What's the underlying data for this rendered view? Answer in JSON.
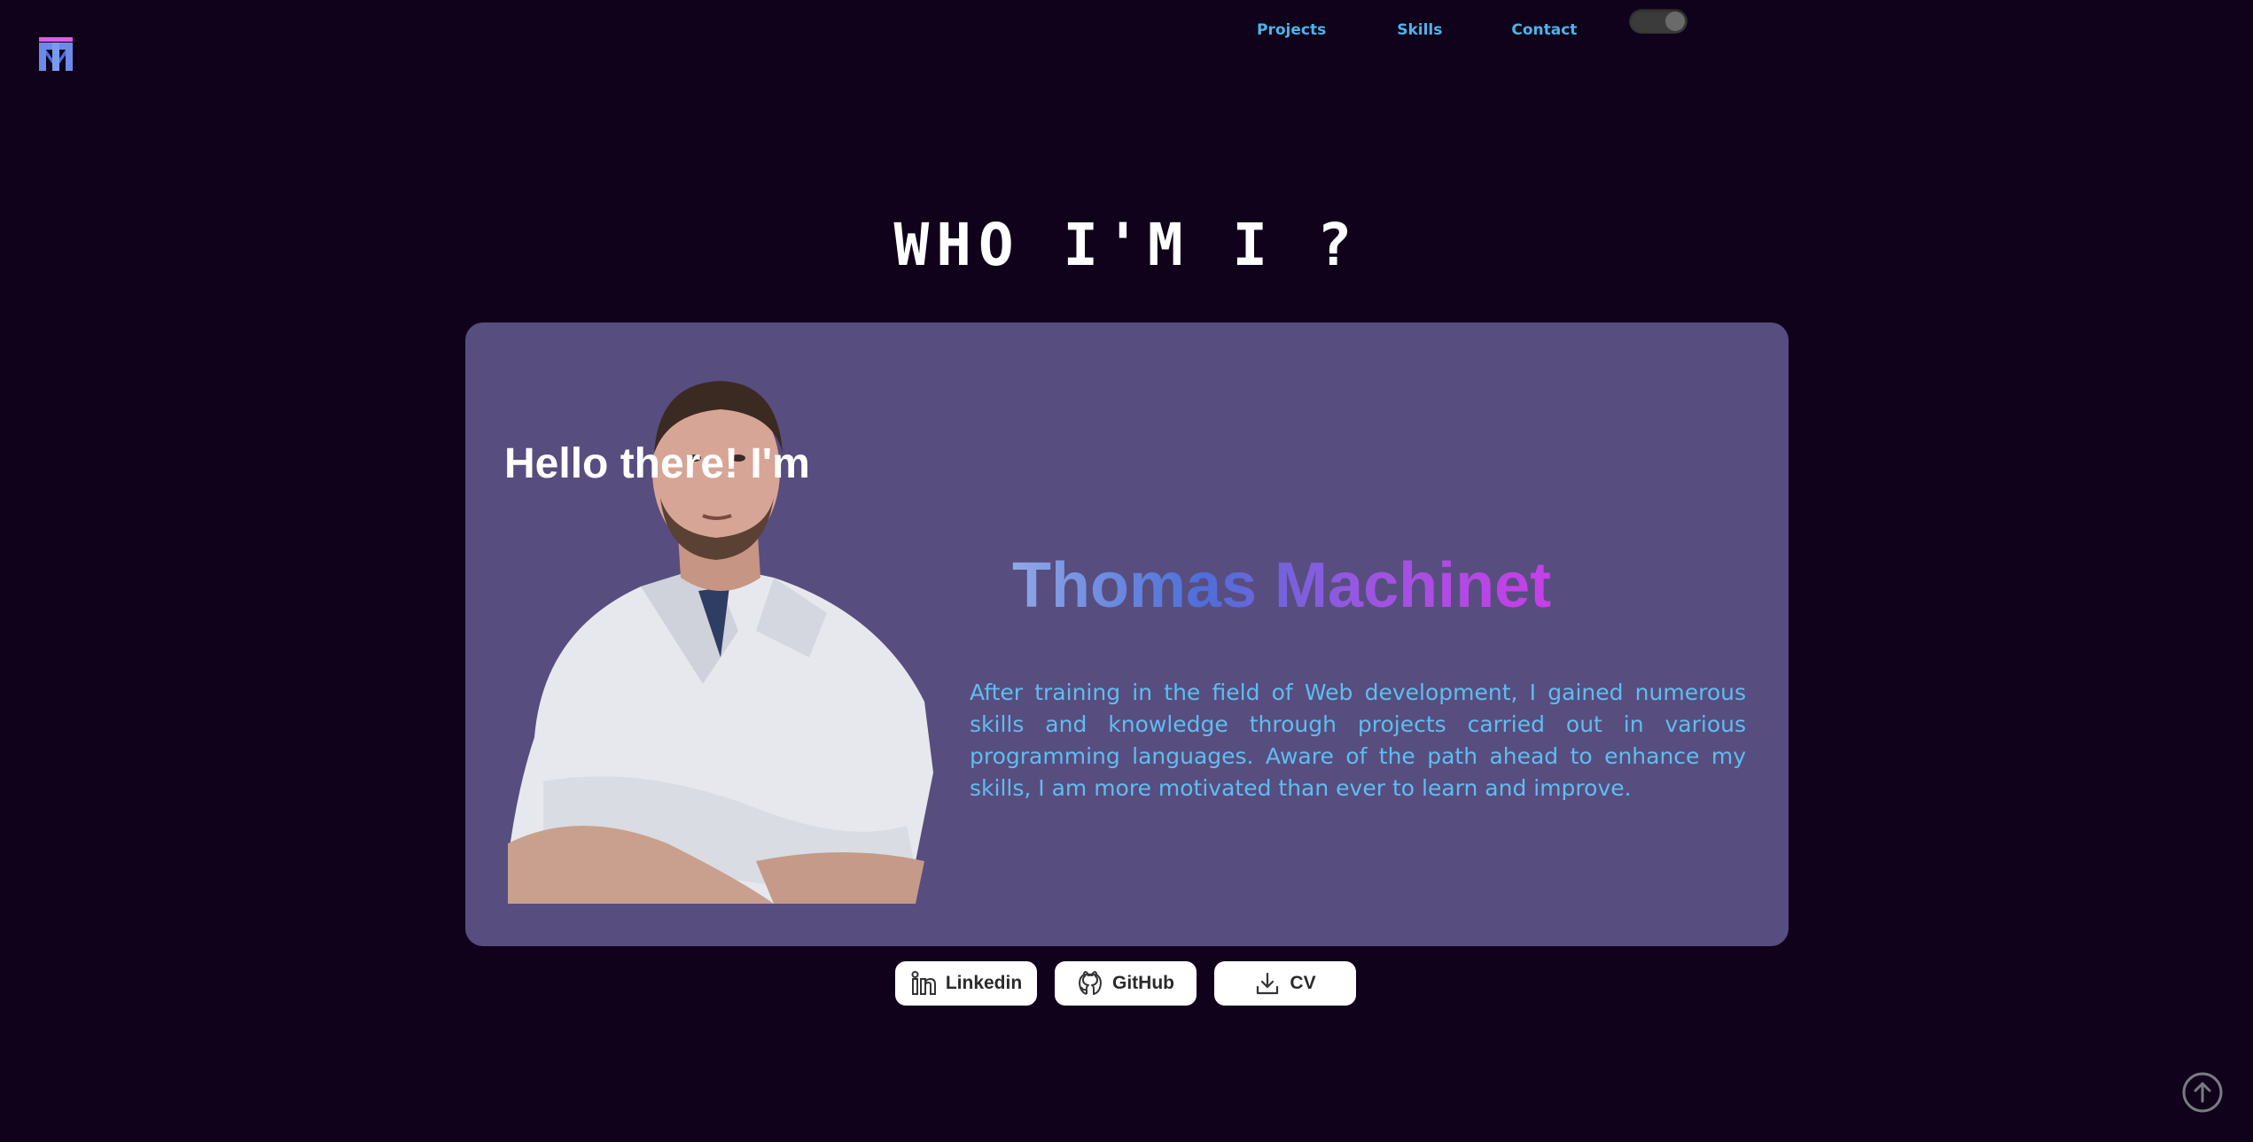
{
  "nav": {
    "projects": "Projects",
    "skills": "Skills",
    "contact": "Contact"
  },
  "theme_toggle": {
    "state": "on"
  },
  "section": {
    "title": "WHO I'M I ?"
  },
  "profile": {
    "greeting": "Hello there! I'm",
    "name": "Thomas Machinet",
    "bio": "After training in the field of Web development, I gained numerous skills and knowledge through projects carried out in various programming languages. Aware of the path ahead to enhance my skills, I am more motivated than ever to learn and improve."
  },
  "links": {
    "linkedin": "Linkedin",
    "github": "GitHub",
    "cv": "CV"
  },
  "icons": [
    "logo-icon",
    "linkedin-icon",
    "github-icon",
    "download-icon",
    "arrow-up-icon"
  ],
  "colors": {
    "background": "#0f021a",
    "card": "#584d7f",
    "nav_link": "#4fb3e8",
    "bio_text": "#5fbdf0",
    "name_gradient_start": "#8fa8e6",
    "name_gradient_end": "#c83ee8"
  }
}
